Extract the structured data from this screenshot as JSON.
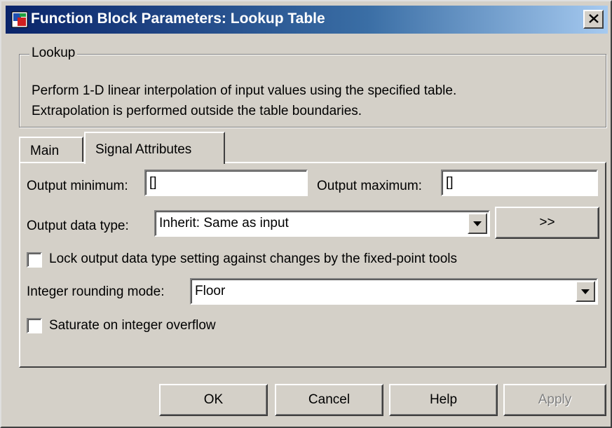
{
  "window": {
    "title": "Function Block Parameters: Lookup Table",
    "icon": "simulink-block-icon",
    "close_icon": "close-icon",
    "titlebar_color": "#0a246a"
  },
  "group": {
    "legend": "Lookup",
    "description_line1": "Perform 1-D linear interpolation of input values using the specified table.",
    "description_line2": "Extrapolation is performed outside the table boundaries."
  },
  "tabs": [
    {
      "label": "Main",
      "selected": false
    },
    {
      "label": "Signal Attributes",
      "selected": true
    }
  ],
  "signal_attributes": {
    "output_minimum_label": "Output minimum:",
    "output_minimum_value": "[]",
    "output_maximum_label": "Output maximum:",
    "output_maximum_value": "[]",
    "output_data_type_label": "Output data type:",
    "output_data_type_value": "Inherit: Same as input",
    "data_type_assistant_label": ">>",
    "lock_output_label": "Lock output data type setting against changes by the fixed-point tools",
    "lock_output_checked": false,
    "rounding_mode_label": "Integer rounding mode:",
    "rounding_mode_value": "Floor",
    "saturate_label": "Saturate on integer overflow",
    "saturate_checked": false
  },
  "buttons": {
    "ok": "OK",
    "cancel": "Cancel",
    "help": "Help",
    "apply": "Apply",
    "apply_enabled": false
  }
}
